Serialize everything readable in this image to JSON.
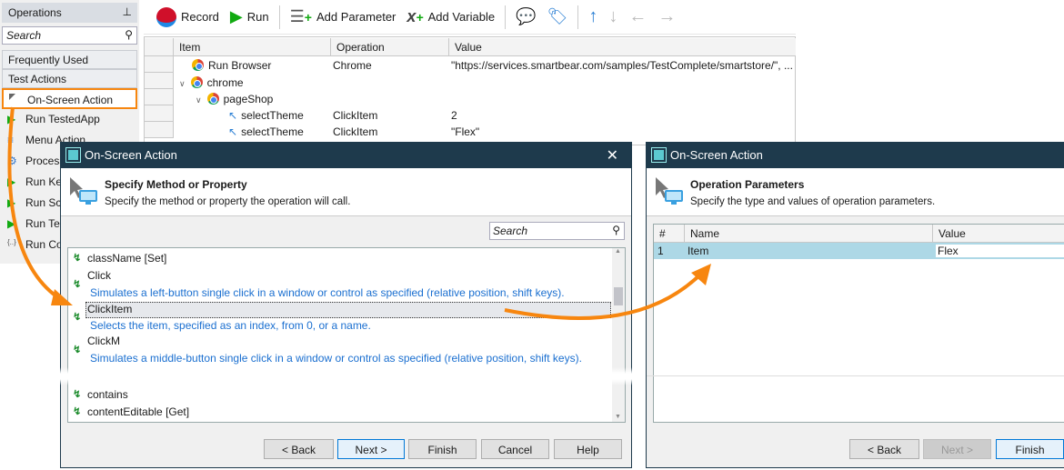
{
  "operations": {
    "title": "Operations",
    "search_placeholder": "Search",
    "categories": [
      "Frequently Used",
      "Test Actions"
    ],
    "items": [
      "On-Screen Action",
      "Run TestedApp",
      "Menu Action",
      "Process",
      "Run Key",
      "Run Scr",
      "Run Tes",
      "Run Coo"
    ]
  },
  "toolbar": {
    "record": "Record",
    "run": "Run",
    "add_parameter": "Add Parameter",
    "add_variable": "Add Variable"
  },
  "grid": {
    "headers": [
      "Item",
      "Operation",
      "Value"
    ],
    "rows": [
      {
        "item": "Run Browser",
        "operation": "Chrome",
        "value": "\"https://services.smartbear.com/samples/TestComplete/smartstore/\", ..."
      },
      {
        "item": "chrome",
        "operation": "",
        "value": ""
      },
      {
        "item": "pageShop",
        "operation": "",
        "value": ""
      },
      {
        "item": "selectTheme",
        "operation": "ClickItem",
        "value": "2"
      },
      {
        "item": "selectTheme",
        "operation": "ClickItem",
        "value": "\"Flex\""
      }
    ]
  },
  "dialog1": {
    "title": "On-Screen Action",
    "heading": "Specify Method or Property",
    "subheading": "Specify the method or property the operation will call.",
    "search_placeholder": "Search",
    "members": [
      {
        "name": "className [Set]"
      },
      {
        "name": "Click",
        "desc": "Simulates a left-button single click in a window or control as specified (relative position, shift keys)."
      },
      {
        "name": "ClickItem",
        "desc": "Selects the item, specified as an index, from 0, or a name."
      },
      {
        "name": "ClickM",
        "desc": "Simulates a middle-button single click in a window or control as specified (relative position, shift keys)."
      },
      {
        "name": "contains"
      },
      {
        "name": "contentEditable [Get]"
      }
    ],
    "buttons": {
      "back": "< Back",
      "next": "Next >",
      "finish": "Finish",
      "cancel": "Cancel",
      "help": "Help"
    }
  },
  "dialog2": {
    "title": "On-Screen Action",
    "heading": "Operation Parameters",
    "subheading": "Specify the type and values of operation parameters.",
    "headers": [
      "#",
      "Name",
      "Value"
    ],
    "rows": [
      {
        "num": "1",
        "name": "Item",
        "value": "Flex"
      }
    ],
    "buttons": {
      "back": "< Back",
      "next": "Next >",
      "finish": "Finish"
    }
  },
  "colors": {
    "accent": "#f7860f",
    "title_bar": "#1e3a4c",
    "selection": "#add8e6"
  }
}
